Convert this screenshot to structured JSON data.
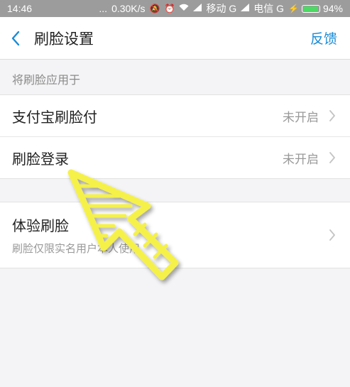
{
  "status_bar": {
    "time": "14:46",
    "dots": "...",
    "speed": "0.30K/s",
    "carrier1": "移动 G",
    "carrier2": "电信 G",
    "battery_percent": "94%",
    "battery_level": 0.94,
    "battery_color": "#4cd964"
  },
  "header": {
    "title": "刷脸设置",
    "action": "反馈",
    "accent": "#1a8bd6"
  },
  "section": {
    "label": "将刷脸应用于"
  },
  "items": [
    {
      "label": "支付宝刷脸付",
      "status": "未开启"
    },
    {
      "label": "刷脸登录",
      "status": "未开启"
    }
  ],
  "experience": {
    "label": "体验刷脸",
    "sub": "刷脸仅限实名用户本人使用"
  },
  "annotation": {
    "color": "#f5f14a"
  }
}
